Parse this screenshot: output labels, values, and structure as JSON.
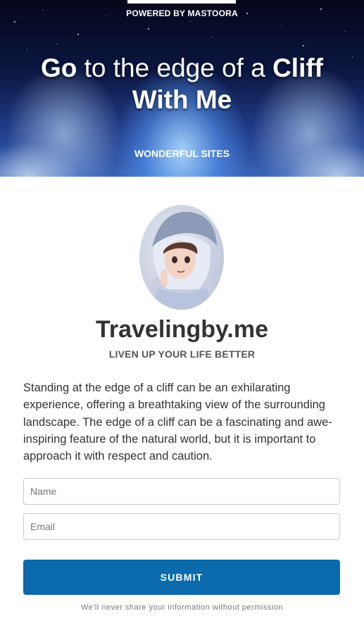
{
  "hero": {
    "powered_by": "POWERED BY MASTOORA",
    "headline": {
      "part1": "Go",
      "part2": " to the edge of a ",
      "part3": "Cliff",
      "part4": "With Me"
    },
    "category": "WONDERFUL SITES"
  },
  "profile": {
    "avatar_icon": "avatar-girl-illustration",
    "site_name": "Travelingby.me",
    "tagline": "LIVEN UP YOUR LIFE BETTER"
  },
  "description": "Standing at the edge of a cliff can be an exhilarating experience, offering a breathtaking view of the surrounding landscape. The edge of a cliff can be a fascinating and awe-inspiring feature of the natural world, but it is important to approach it with respect and caution.",
  "form": {
    "name_placeholder": "Name",
    "email_placeholder": "Email",
    "submit_label": "SUBMIT",
    "privacy_note": "We'll never share your information without permission"
  },
  "colors": {
    "accent": "#0a6aac",
    "text": "#333333"
  }
}
